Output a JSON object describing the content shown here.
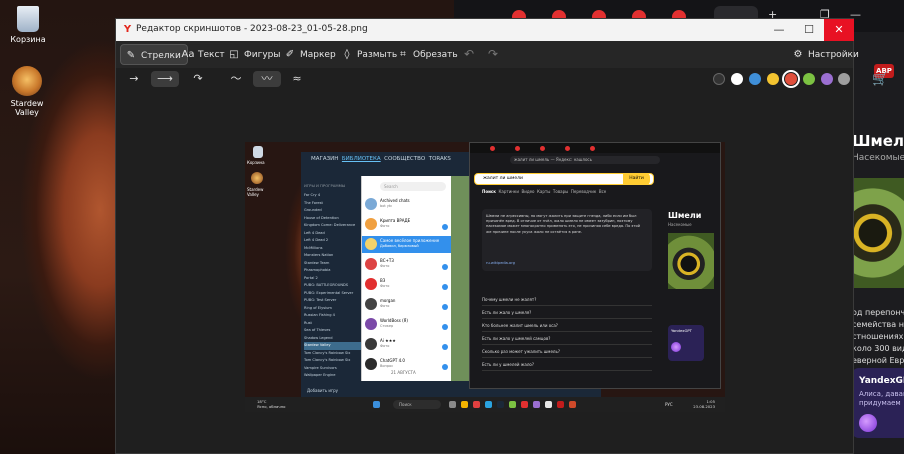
{
  "desktop": {
    "icons": [
      {
        "label": "Корзина"
      },
      {
        "label": "Stardew Valley"
      }
    ]
  },
  "browser_behind": {
    "adblock_label": "ABP",
    "heading": "Шмели",
    "subheading": "Насекомые",
    "snippet_lines": [
      "од перепончат",
      "семейства наст",
      "стношениях бл",
      "коло 300 видо",
      "еверной Евраз"
    ],
    "alice_title": "YandexGP",
    "alice_text_lines": [
      "Алиса, давай",
      "придумаем"
    ]
  },
  "editor": {
    "title": "Редактор скриншотов - 2023-08-23_01-05-28.png",
    "window_controls": {
      "minimize": "—",
      "maximize": "☐",
      "close": "✕"
    },
    "tools": [
      {
        "label": "Стрелки",
        "icon": "pen-arrow-icon",
        "active": true
      },
      {
        "label": "Текст",
        "icon": "text-icon",
        "active": false
      },
      {
        "label": "Фигуры",
        "icon": "shapes-icon",
        "active": false
      },
      {
        "label": "Маркер",
        "icon": "marker-icon",
        "active": false
      },
      {
        "label": "Размыть",
        "icon": "blur-drop-icon",
        "active": false
      },
      {
        "label": "Обрезать",
        "icon": "crop-icon",
        "active": false
      }
    ],
    "settings_label": "Настройки",
    "colors": [
      "#333333",
      "#ffffff",
      "#3f8fd8",
      "#f4c430",
      "#e04f3c",
      "#7cc242",
      "#9b6fd1",
      "#9e9e9e"
    ],
    "selected_color_index": 4
  },
  "inner_screenshot": {
    "desktop_labels": [
      "Корзина",
      "Stardew Valley"
    ],
    "steam": {
      "nav": [
        "МАГАЗИН",
        "БИБЛИОТЕКА",
        "СООБЩЕСТВО",
        "TORAKS"
      ],
      "section": "ИГРЫ И ПРОГРАММЫ",
      "games": [
        "Far Cry 4",
        "The Forest",
        "Grounded",
        "House of Detention",
        "Kingdom Come: Deliverance",
        "Left 4 Dead",
        "Left 4 Dead 2",
        "McMillions",
        "Monsters Nation",
        "Stardew Team",
        "Phasmophobia",
        "Portal 2",
        "PUBG: BATTLEGROUNDS",
        "PUBG: Experimental Server",
        "PUBG: Test Server",
        "Ring of Elysium",
        "Russian Fishing 4",
        "Rust",
        "Sea of Thieves",
        "Shadow Legend",
        "Stardew Valley",
        "Tom Clancy's Rainbow Six",
        "Tom Clancy's Rainbow Six",
        "Vampire Survivors",
        "Wallpaper Engine"
      ],
      "selected_game_index": 20,
      "add_game": "Добавить игру"
    },
    "telegram": {
      "search_placeholder": "Search",
      "chats": [
        {
          "name": "Archived chats",
          "msg": "bot ytc"
        },
        {
          "name": "Крипта ВРАДЕ",
          "msg": "Фото"
        },
        {
          "name": "Самое весёлое приложение",
          "msg": "Добавил, бирюзовый"
        },
        {
          "name": "ВС+Т3",
          "msg": "Фото"
        },
        {
          "name": "ВЗ",
          "msg": "Фото"
        },
        {
          "name": "morgan",
          "msg": "Фото"
        },
        {
          "name": "WorldBoss (Я)",
          "msg": "Стикер"
        },
        {
          "name": "Ai ★★★",
          "msg": "Фото"
        },
        {
          "name": "ChatGPT 4.0",
          "msg": "Вопрос"
        }
      ],
      "selected_chat_index": 2,
      "date_label": "21 АВГУСТА"
    },
    "yandex": {
      "address": "жалит ли шмель — Яндекс: нашлось",
      "query": "жалит ли шмели",
      "find_button": "Найти",
      "tabs": [
        "Поиск",
        "Картинки",
        "Видео",
        "Карты",
        "Товары",
        "Переводчик",
        "Все"
      ],
      "answer": "Шмели не агрессивны, но могут жалить при защите гнезда, либо если им был причинён вред. В отличие от пчёл, жало шмеля не имеет зазубрин, поэтому насекомое может многократно применять его, не причиняя себе вреда. По этой же причине после укуса жало не остаётся в ране.",
      "source": "ru.wikipedia.org",
      "questions": [
        "Почему шмели не жалят?",
        "Есть ли жало у шмеля?",
        "Кто больнее жалит шмель или оса?",
        "Есть ли жало у шмелей самцов?",
        "Сколько раз может ужалить шмель?",
        "Есть ли у шмелей жало?"
      ],
      "panel_title": "Шмели",
      "panel_subtitle": "Насекомые",
      "alice_title": "YandexGPT"
    },
    "taskbar": {
      "weather_temp": "18°C",
      "weather_text": "Ясно, облачно",
      "search_label": "Поиск",
      "lang": "РУС",
      "time": "1:05",
      "date": "23.08.2023"
    }
  }
}
